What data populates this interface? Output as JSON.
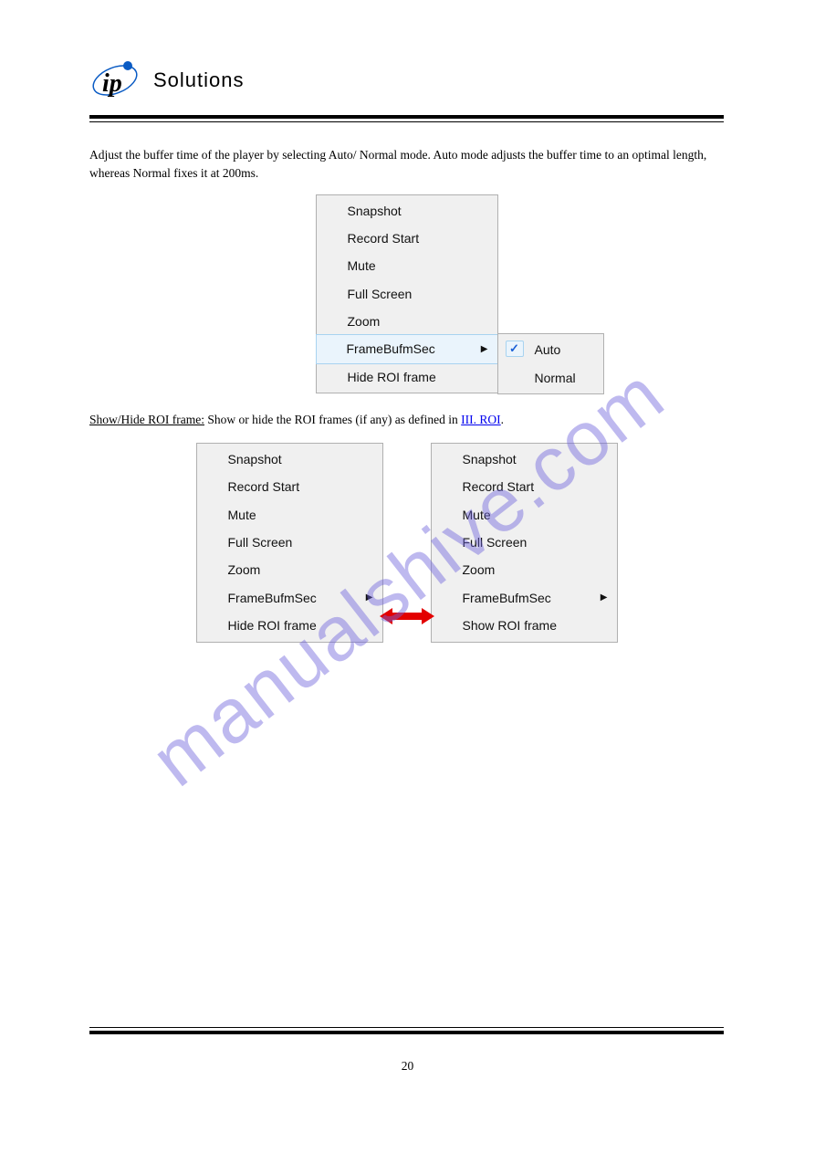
{
  "header": {
    "brand": "Solutions"
  },
  "content": {
    "intro_para": "Adjust the buffer time of the player by selecting Auto/ Normal mode. Auto mode adjusts the buffer time to an optimal length, whereas Normal fixes it at 200ms.",
    "roi_para_prefix": "Show/Hide ROI frame:",
    "roi_para_body": " Show or hide the ROI frames (if any) as defined in ",
    "roi_link": "III. ROI",
    "roi_para_end": "."
  },
  "menu1": {
    "items": [
      "Snapshot",
      "Record Start",
      "Mute",
      "Full Screen",
      "Zoom",
      "FrameBufmSec",
      "Hide ROI frame"
    ],
    "submenu": [
      "Auto",
      "Normal"
    ]
  },
  "menu_left": {
    "items": [
      "Snapshot",
      "Record Start",
      "Mute",
      "Full Screen",
      "Zoom",
      "FrameBufmSec",
      "Hide ROI frame"
    ]
  },
  "menu_right": {
    "items": [
      "Snapshot",
      "Record Start",
      "Mute",
      "Full Screen",
      "Zoom",
      "FrameBufmSec",
      "Show ROI frame"
    ]
  },
  "page_number": "20"
}
